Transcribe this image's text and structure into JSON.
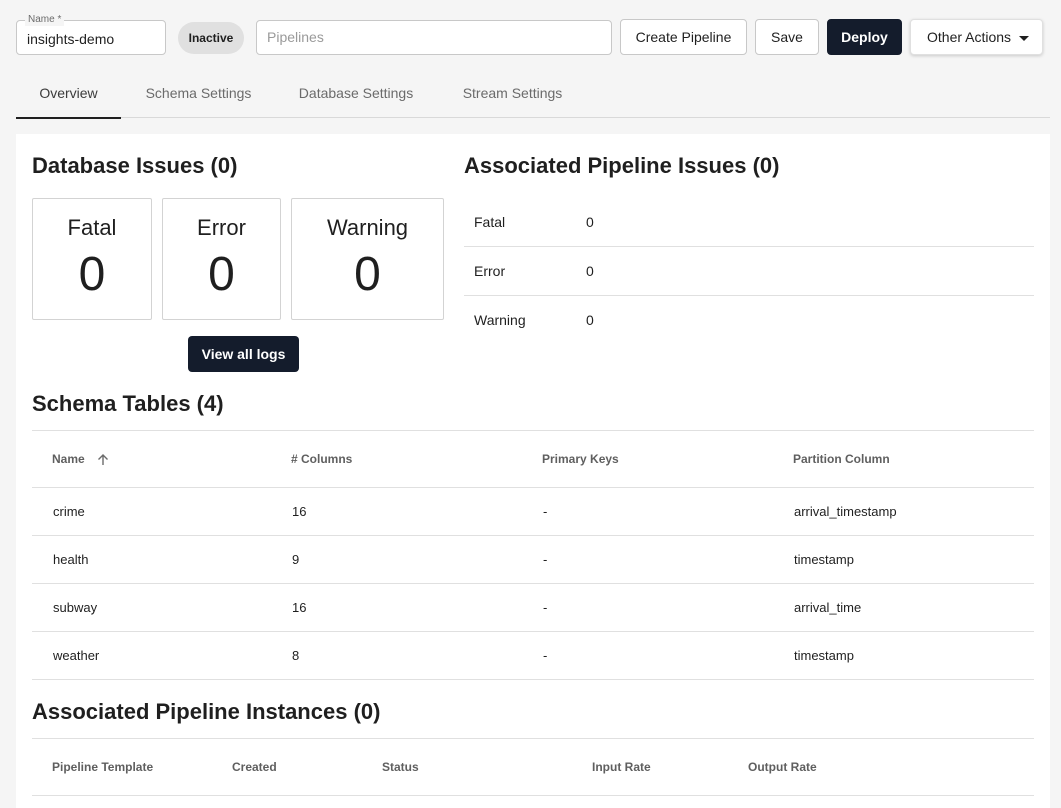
{
  "toolbar": {
    "name_label": "Name *",
    "name_value": "insights-demo",
    "status": "Inactive",
    "pipelines_placeholder": "Pipelines",
    "create_pipeline_label": "Create Pipeline",
    "save_label": "Save",
    "deploy_label": "Deploy",
    "other_actions_label": "Other Actions"
  },
  "tabs": [
    {
      "label": "Overview",
      "active": true
    },
    {
      "label": "Schema Settings",
      "active": false
    },
    {
      "label": "Database Settings",
      "active": false
    },
    {
      "label": "Stream Settings",
      "active": false
    }
  ],
  "database_issues": {
    "title": "Database Issues (0)",
    "cards": [
      {
        "label": "Fatal",
        "count": "0"
      },
      {
        "label": "Error",
        "count": "0"
      },
      {
        "label": "Warning",
        "count": "0"
      }
    ],
    "view_logs_label": "View all logs"
  },
  "pipeline_issues": {
    "title": "Associated Pipeline Issues (0)",
    "rows": [
      {
        "label": "Fatal",
        "count": "0"
      },
      {
        "label": "Error",
        "count": "0"
      },
      {
        "label": "Warning",
        "count": "0"
      }
    ]
  },
  "schema_tables": {
    "title": "Schema Tables (4)",
    "columns": [
      "Name",
      "# Columns",
      "Primary Keys",
      "Partition Column"
    ],
    "rows": [
      {
        "name": "crime",
        "columns": "16",
        "primary_keys": "-",
        "partition": "arrival_timestamp"
      },
      {
        "name": "health",
        "columns": "9",
        "primary_keys": "-",
        "partition": "timestamp"
      },
      {
        "name": "subway",
        "columns": "16",
        "primary_keys": "-",
        "partition": "arrival_time"
      },
      {
        "name": "weather",
        "columns": "8",
        "primary_keys": "-",
        "partition": "timestamp"
      }
    ]
  },
  "pipeline_instances": {
    "title": "Associated Pipeline Instances (0)",
    "columns": [
      "Pipeline Template",
      "Created",
      "Status",
      "Input Rate",
      "Output Rate"
    ]
  },
  "colors": {
    "primary_dark": "#141c2c",
    "chip_bg": "#e0e0e0",
    "page_bg": "#f5f5f5"
  },
  "icons": {
    "sort": "arrow-up-icon",
    "dropdown": "caret-down-icon"
  }
}
